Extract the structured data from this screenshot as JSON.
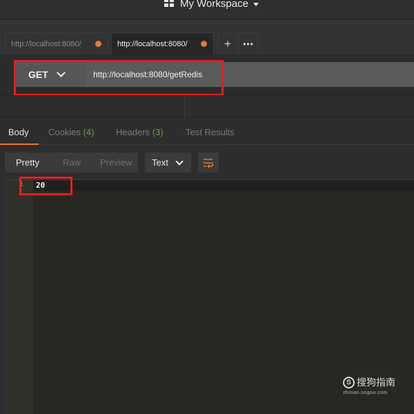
{
  "workspace": {
    "title": "My Workspace",
    "icon": "grid-icon"
  },
  "tabs": [
    {
      "label": "http://localhost:8080/",
      "active": false,
      "unsaved": true
    },
    {
      "label": "http://localhost:8080/",
      "active": true,
      "unsaved": true
    }
  ],
  "tab_actions": {
    "add_label": "+",
    "more_label": "•••"
  },
  "request": {
    "method": "GET",
    "url": "http://localhost:8080/getRedis"
  },
  "response_tabs": {
    "body": "Body",
    "cookies": "Cookies",
    "cookies_count": "(4)",
    "headers": "Headers",
    "headers_count": "(3)",
    "test_results": "Test Results"
  },
  "format": {
    "pretty": "Pretty",
    "raw": "Raw",
    "preview": "Preview",
    "type": "Text",
    "wrap_icon": "wrap-lines-icon"
  },
  "editor": {
    "line_number": "1",
    "content": "20"
  },
  "watermark": {
    "text": "搜狗指南",
    "badge": "S",
    "url": "zhinan.sogou.com"
  },
  "colors": {
    "accent": "#e8772e",
    "highlight_box": "#e02020",
    "count": "#5ea83a"
  }
}
